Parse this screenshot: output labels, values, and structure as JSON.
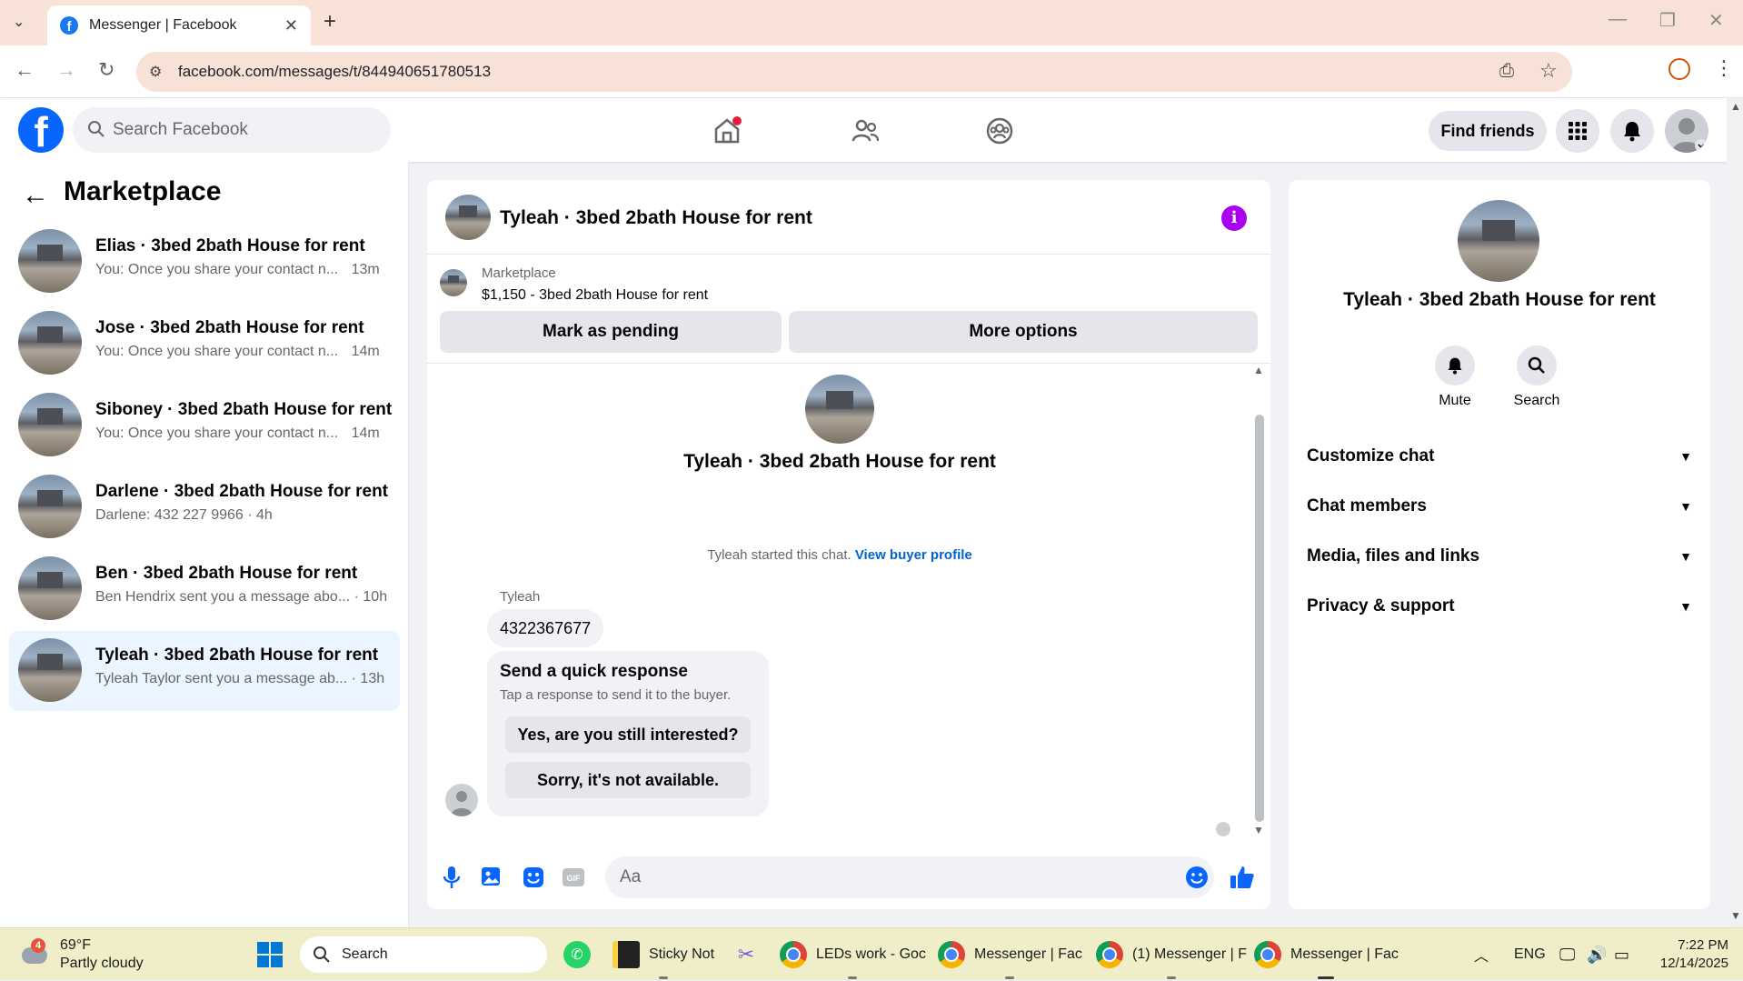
{
  "browser": {
    "tab_title": "Messenger | Facebook",
    "url": "facebook.com/messages/t/844940651780513"
  },
  "header": {
    "search_placeholder": "Search Facebook",
    "find_friends": "Find friends"
  },
  "left": {
    "title": "Marketplace",
    "conversations": [
      {
        "name": "Elias · 3bed 2bath House for rent",
        "snippet": "You: Once you share your contact n...",
        "time": "13m"
      },
      {
        "name": "Jose · 3bed 2bath House for rent",
        "snippet": "You: Once you share your contact n...",
        "time": "14m"
      },
      {
        "name": "Siboney · 3bed 2bath House for rent",
        "snippet": "You: Once you share your contact n...",
        "time": "14m"
      },
      {
        "name": "Darlene · 3bed 2bath House for rent",
        "snippet": "Darlene: 432 227 9966",
        "time": "4h"
      },
      {
        "name": "Ben · 3bed 2bath House for rent",
        "snippet": "Ben Hendrix sent you a message abo...",
        "time": "10h"
      },
      {
        "name": "Tyleah · 3bed 2bath House for rent",
        "snippet": "Tyleah Taylor sent you a message ab...",
        "time": "13h"
      }
    ]
  },
  "chat": {
    "title": "Tyleah · 3bed 2bath House for rent",
    "marketplace_label": "Marketplace",
    "listing": "$1,150 - 3bed 2bath House for rent",
    "mark_pending": "Mark as pending",
    "more_options": "More options",
    "started_text": "Tyleah started this chat.",
    "view_profile": "View buyer profile",
    "sender": "Tyleah",
    "message": "4322367677",
    "quick_title": "Send a quick response",
    "quick_sub": "Tap a response to send it to the buyer.",
    "quick_1": "Yes, are you still interested?",
    "quick_2": "Sorry, it's not available.",
    "input_placeholder": "Aa"
  },
  "right": {
    "name": "Tyleah · 3bed 2bath House for rent",
    "mute": "Mute",
    "search": "Search",
    "sections": [
      "Customize chat",
      "Chat members",
      "Media, files and links",
      "Privacy & support"
    ]
  },
  "taskbar": {
    "weather_badge": "4",
    "temp": "69°F",
    "condition": "Partly cloudy",
    "search": "Search",
    "sticky": "Sticky Not",
    "chrome1": "LEDs work - Goc",
    "chrome2": "Messenger | Fac",
    "chrome3": "(1) Messenger | F",
    "chrome4": "Messenger | Fac",
    "lang": "ENG",
    "time": "7:22 PM",
    "date": "12/14/2025"
  },
  "colors": {
    "facebook_blue": "#0866ff",
    "link_blue": "#0064d1",
    "info_purple": "#a700f0",
    "active_conv": "#ebf5ff"
  }
}
